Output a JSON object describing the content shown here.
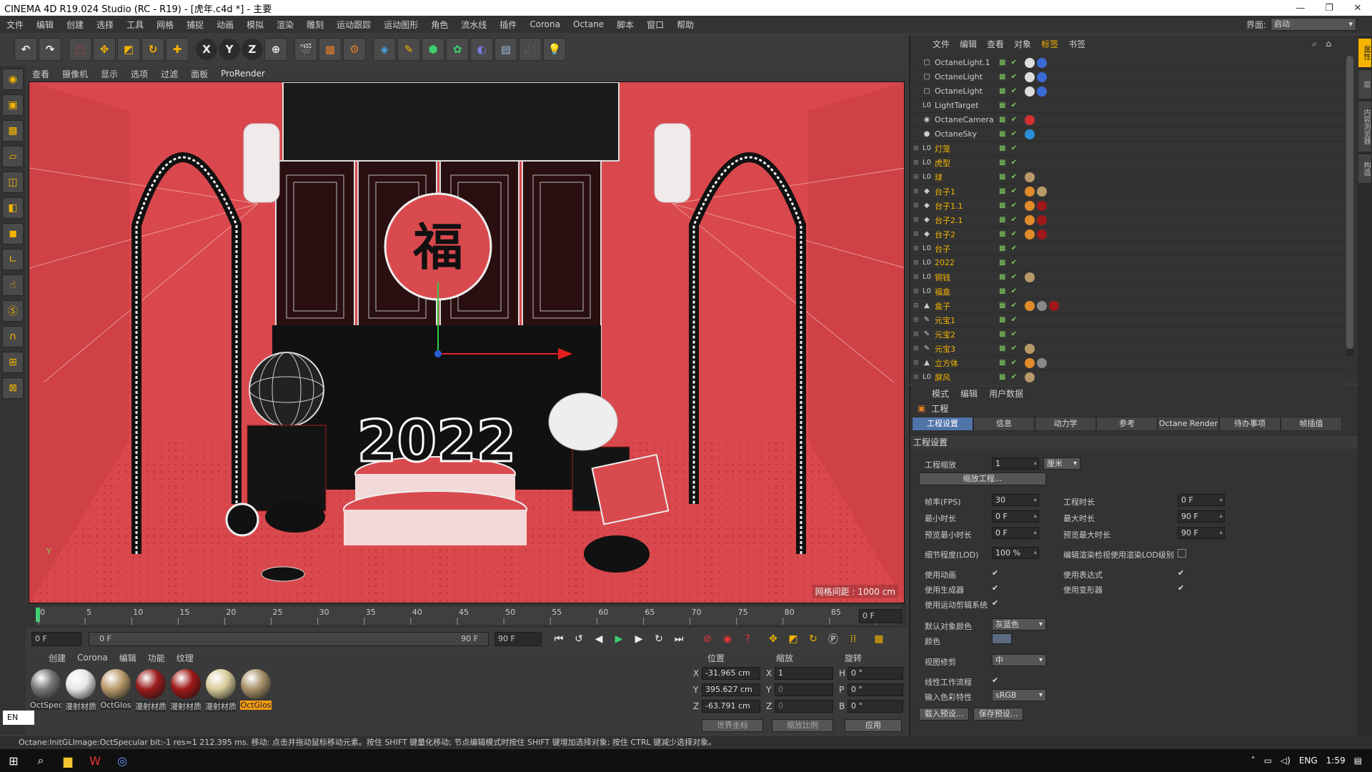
{
  "window": {
    "title": "CINEMA 4D R19.024 Studio (RC - R19) - [虎年.c4d *] - 主要",
    "minimize": "—",
    "maximize": "❐",
    "close": "✕"
  },
  "menubar": {
    "items": [
      "文件",
      "编辑",
      "创建",
      "选择",
      "工具",
      "网格",
      "捕捉",
      "动画",
      "模拟",
      "渲染",
      "雕刻",
      "运动跟踪",
      "运动图形",
      "角色",
      "流水线",
      "插件",
      "Corona",
      "Octane",
      "脚本",
      "窗口",
      "帮助"
    ],
    "layout_label": "界面:",
    "layout_value": "启动"
  },
  "viewport": {
    "menu": [
      "查看",
      "摄像机",
      "显示",
      "选项",
      "过滤",
      "面板"
    ],
    "renderer": "ProRender",
    "grid_info": "网格间距 : 1000 cm",
    "axis_y": "Y",
    "scene_text": "2022"
  },
  "timeline": {
    "ticks": [
      "0",
      "5",
      "10",
      "15",
      "20",
      "25",
      "30",
      "35",
      "40",
      "45",
      "50",
      "55",
      "60",
      "65",
      "70",
      "75",
      "80",
      "85",
      "90"
    ],
    "current": "0 F",
    "start": "0 F",
    "range_start": "0 F",
    "range_end": "90 F",
    "end": "90 F"
  },
  "materials": {
    "menu": [
      "创建",
      "Corona",
      "编辑",
      "功能",
      "纹理"
    ],
    "items": [
      {
        "name": "OctSpec",
        "color": "#777"
      },
      {
        "name": "漫射材质",
        "color": "#e6e6e6"
      },
      {
        "name": "OctGlos",
        "color": "#b89a6a"
      },
      {
        "name": "漫射材质",
        "color": "#9a1c1c"
      },
      {
        "name": "漫射材质",
        "color": "#a01818"
      },
      {
        "name": "漫射材质",
        "color": "#d9cc9c"
      },
      {
        "name": "OctGlos",
        "color": "#a8926a"
      }
    ],
    "lang": "EN"
  },
  "coords": {
    "headers": [
      "位置",
      "缩放",
      "旋转"
    ],
    "rows": [
      {
        "axis": "X",
        "pos": "-31.965 cm",
        "saxis": "X",
        "scale": "1",
        "raxis": "H",
        "rot": "0 °"
      },
      {
        "axis": "Y",
        "pos": "395.627 cm",
        "saxis": "Y",
        "scale": "0",
        "raxis": "P",
        "rot": "0 °"
      },
      {
        "axis": "Z",
        "pos": "-63.791 cm",
        "saxis": "Z",
        "scale": "0",
        "raxis": "B",
        "rot": "0 °"
      }
    ],
    "world": "世界坐标",
    "scale_mode": "缩放比例",
    "apply": "应用"
  },
  "objects": {
    "menu": [
      "文件",
      "编辑",
      "查看",
      "对象",
      "标签",
      "书签"
    ],
    "active_menu": "标签",
    "rows": [
      {
        "name": "OctaneLight.1",
        "icon": "▢",
        "yellow": false,
        "tags": [
          "#ddd",
          "#3a6bd6"
        ]
      },
      {
        "name": "OctaneLight",
        "icon": "▢",
        "yellow": false,
        "tags": [
          "#ddd",
          "#3a6bd6"
        ]
      },
      {
        "name": "OctaneLight",
        "icon": "▢",
        "yellow": false,
        "tags": [
          "#ddd",
          "#3a6bd6"
        ]
      },
      {
        "name": "LightTarget",
        "icon": "L0",
        "yellow": false,
        "tags": []
      },
      {
        "name": "OctaneCamera",
        "icon": "◉",
        "yellow": false,
        "tags": [
          "#d43030"
        ]
      },
      {
        "name": "OctaneSky",
        "icon": "●",
        "yellow": false,
        "tags": [
          "#2a8fd8"
        ]
      },
      {
        "name": "灯笼",
        "icon": "L0",
        "yellow": true,
        "tags": []
      },
      {
        "name": "虎型",
        "icon": "L0",
        "yellow": true,
        "tags": []
      },
      {
        "name": "球",
        "icon": "L0",
        "yellow": true,
        "tags": [
          "#b89a6a"
        ]
      },
      {
        "name": "台子1",
        "icon": "◆",
        "yellow": true,
        "tags": [
          "#e08a2a",
          "#b89a6a"
        ]
      },
      {
        "name": "台子1.1",
        "icon": "◆",
        "yellow": true,
        "tags": [
          "#e08a2a",
          "#a01818"
        ]
      },
      {
        "name": "台子2.1",
        "icon": "◆",
        "yellow": true,
        "tags": [
          "#e08a2a",
          "#a01818"
        ]
      },
      {
        "name": "台子2",
        "icon": "◆",
        "yellow": true,
        "tags": [
          "#e08a2a",
          "#a01818"
        ]
      },
      {
        "name": "台子",
        "icon": "L0",
        "yellow": true,
        "tags": []
      },
      {
        "name": "2022",
        "icon": "L0",
        "yellow": true,
        "tags": []
      },
      {
        "name": "铜钱",
        "icon": "L0",
        "yellow": true,
        "tags": [
          "#b89a6a"
        ]
      },
      {
        "name": "福盒",
        "icon": "L0",
        "yellow": true,
        "tags": []
      },
      {
        "name": "盒子",
        "icon": "▲",
        "yellow": true,
        "tags": [
          "#e08a2a",
          "#888",
          "#a01818"
        ]
      },
      {
        "name": "元宝1",
        "icon": "✎",
        "yellow": true,
        "tags": []
      },
      {
        "name": "元宝2",
        "icon": "✎",
        "yellow": true,
        "tags": []
      },
      {
        "name": "元宝3",
        "icon": "✎",
        "yellow": true,
        "tags": [
          "#b89a6a"
        ]
      },
      {
        "name": "立方体",
        "icon": "▲",
        "yellow": true,
        "tags": [
          "#e08a2a",
          "#888"
        ]
      },
      {
        "name": "屏风",
        "icon": "L0",
        "yellow": true,
        "tags": [
          "#b89a6a"
        ]
      }
    ]
  },
  "attributes": {
    "menu": [
      "模式",
      "编辑",
      "用户数据"
    ],
    "title": "工程",
    "tabs": [
      "工程设置",
      "信息",
      "动力学",
      "参考",
      "Octane Render",
      "待办事项",
      "帧插值"
    ],
    "section": "工程设置",
    "scale_label": "工程缩放",
    "scale_value": "1",
    "scale_unit": "厘米",
    "scale_btn": "缩放工程...",
    "fps_label": "帧率(FPS)",
    "fps": "30",
    "duration_label": "工程时长",
    "duration": "0 F",
    "min_label": "最小时长",
    "min": "0 F",
    "max_label": "最大时长",
    "max": "90 F",
    "pmin_label": "预览最小时长",
    "pmin": "0 F",
    "pmax_label": "预览最大时长",
    "pmax": "90 F",
    "lod_label": "细节程度(LOD)",
    "lod": "100 %",
    "lod_render_label": "编辑渲染检视使用渲染LOD级别",
    "use_anim": "使用动画",
    "use_expr": "使用表达式",
    "use_gen": "使用生成器",
    "use_deform": "使用变形器",
    "use_mograph": "使用运动剪辑系统",
    "default_color_label": "默认对象颜色",
    "default_color": "灰蓝色",
    "color_label": "颜色",
    "view_clip_label": "视图修剪",
    "view_clip": "中",
    "linear_label": "线性工作流程",
    "input_color_label": "输入色彩特性",
    "input_color": "sRGB",
    "load_preset": "载入预设...",
    "save_preset": "保存预设..."
  },
  "rightstrip": [
    "属性",
    "层",
    "内容浏览器",
    "构造"
  ],
  "status": {
    "text": "Octane:InitGLImage:OctSpecular  bit:-1 res=1  212.395 ms.     移动: 点击并拖动鼠标移动元素。按住 SHIFT 键量化移动; 节点编辑模式时按住 SHIFT 键增加选择对象; 按住 CTRL 键减少选择对象。"
  },
  "taskbar": {
    "lang": "ENG",
    "time": "1:59"
  }
}
